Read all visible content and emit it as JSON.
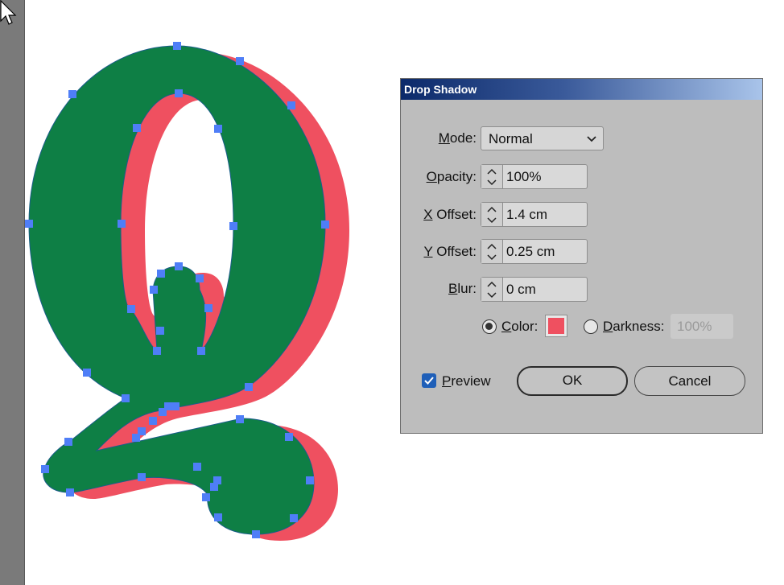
{
  "dialog": {
    "title": "Drop Shadow",
    "mode": {
      "label_u": "M",
      "label_rest": "ode:",
      "value": "Normal"
    },
    "opacity": {
      "label_u": "O",
      "label_rest": "pacity:",
      "value": "100%"
    },
    "x_offset": {
      "label_u": "X",
      "label_rest": " Offset:",
      "value": "1.4 cm"
    },
    "y_offset": {
      "label_u": "Y",
      "label_rest": " Offset:",
      "value": "0.25 cm"
    },
    "blur": {
      "label_u": "B",
      "label_rest": "lur:",
      "value": "0 cm"
    },
    "color": {
      "label_u": "C",
      "label_rest": "olor:",
      "selected": true,
      "swatch": "#ef5060"
    },
    "darkness": {
      "label_u": "D",
      "label_rest": "arkness:",
      "selected": false,
      "value": "100%"
    },
    "preview": {
      "label_u": "P",
      "label_rest": "review",
      "checked": true
    },
    "ok_label": "OK",
    "cancel_label": "Cancel"
  },
  "artwork": {
    "letter": "Q",
    "fill_color": "#0e7f45",
    "shadow_color": "#ef5060",
    "anchor_color": "#4f7ef7"
  },
  "cursor": "arrow-cursor-icon"
}
